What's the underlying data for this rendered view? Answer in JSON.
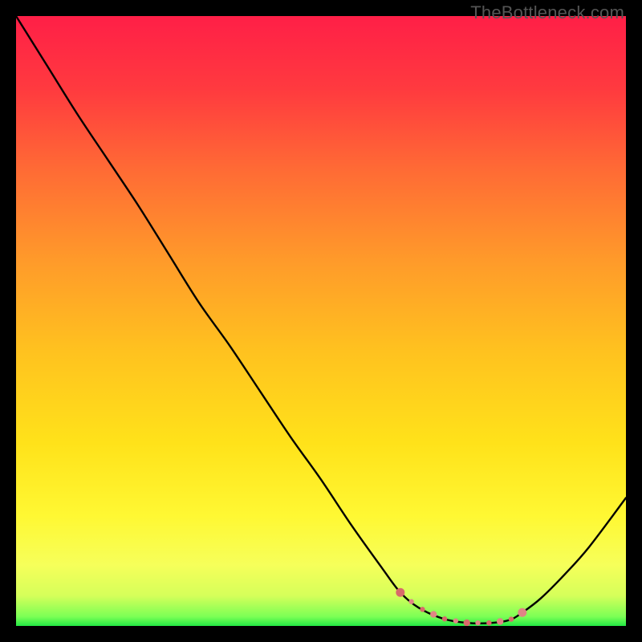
{
  "watermark": "TheBottleneck.com",
  "chart_data": {
    "type": "line",
    "title": "",
    "xlabel": "",
    "ylabel": "",
    "xlim": [
      0,
      100
    ],
    "ylim": [
      0,
      100
    ],
    "x": [
      0,
      5,
      10,
      15,
      20,
      25,
      30,
      35,
      40,
      45,
      50,
      55,
      60,
      63,
      66,
      70,
      74,
      78,
      81,
      83,
      86,
      90,
      94,
      100
    ],
    "y": [
      100,
      92,
      84,
      76.5,
      69,
      61,
      53,
      46,
      38.5,
      31,
      24,
      16.5,
      9.5,
      5.5,
      3,
      1.2,
      0.5,
      0.5,
      1,
      2.2,
      4.5,
      8.5,
      13,
      21
    ],
    "marker_region": {
      "x_start": 63,
      "x_end": 83
    },
    "gradient_stops": [
      {
        "offset": 0.0,
        "color": "#ff1f47"
      },
      {
        "offset": 0.12,
        "color": "#ff3a3f"
      },
      {
        "offset": 0.25,
        "color": "#ff6a35"
      },
      {
        "offset": 0.4,
        "color": "#ff9a2a"
      },
      {
        "offset": 0.55,
        "color": "#ffc21f"
      },
      {
        "offset": 0.7,
        "color": "#ffe21a"
      },
      {
        "offset": 0.82,
        "color": "#fff833"
      },
      {
        "offset": 0.9,
        "color": "#f6ff5a"
      },
      {
        "offset": 0.95,
        "color": "#d6ff5a"
      },
      {
        "offset": 0.985,
        "color": "#7bff55"
      },
      {
        "offset": 1.0,
        "color": "#22e844"
      }
    ],
    "marker_color": "#d86a6a",
    "marker_color_light": "#e08585"
  }
}
